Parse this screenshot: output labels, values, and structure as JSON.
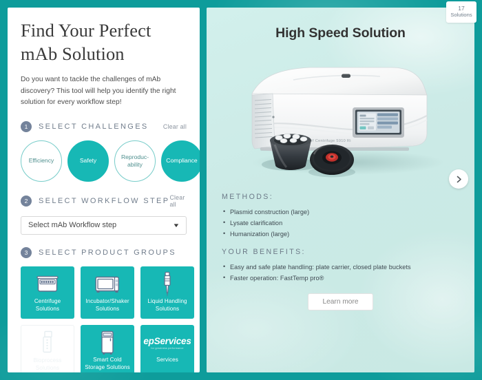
{
  "left": {
    "headline": "Find Your Perfect mAb Solution",
    "intro": "Do you want to tackle the challenges of mAb discovery? This tool will help you identify the right solution for every workflow step!",
    "sections": [
      {
        "number": "1",
        "title": "SELECT CHALLENGES",
        "clear_label": "Clear all"
      },
      {
        "number": "2",
        "title": "SELECT WORKFLOW STEP",
        "clear_label": "Clear all"
      },
      {
        "number": "3",
        "title": "SELECT PRODUCT GROUPS"
      }
    ],
    "challenges": [
      {
        "label": "Efficiency",
        "selected": false
      },
      {
        "label": "Safety",
        "selected": true
      },
      {
        "label": "Reproduc-ability",
        "selected": false
      },
      {
        "label": "Compliance",
        "selected": true
      }
    ],
    "workflow_select": {
      "value": "Select mAb Workflow step",
      "placeholder": "Select mAb Workflow step",
      "caret_icon": "chevron-down-icon"
    },
    "product_groups": [
      {
        "label": "Centrifuge Solutions",
        "icon": "centrifuge-icon",
        "disabled": false
      },
      {
        "label": "Incubator/Shaker Solutions",
        "icon": "incubator-shaker-icon",
        "disabled": false
      },
      {
        "label": "Liquid Handling Solutions",
        "icon": "pipette-icon",
        "disabled": false
      },
      {
        "label": "Bioprocess Solutions",
        "icon": "bioprocess-icon",
        "disabled": true
      },
      {
        "label": "Smart Cold Storage Solutions",
        "icon": "freezer-icon",
        "disabled": false
      },
      {
        "label": "Services",
        "icon": "epservices-logo-icon",
        "disabled": false,
        "logo_text": "epServices",
        "logo_tagline": "for greatness performance"
      }
    ]
  },
  "right": {
    "title": "High Speed Solution",
    "product_image_alt": "eppendorf-centrifuge-image",
    "next_button_icon": "chevron-right-icon",
    "methods_heading": "METHODS:",
    "methods": [
      "Plasmid construction (large)",
      "Lysate clarification",
      "Humanization (large)"
    ],
    "benefits_heading": "YOUR BENEFITS:",
    "benefits": [
      "Easy and safe plate handling: plate carrier, closed plate buckets",
      "Faster operation: FastTemp pro®"
    ],
    "learn_more_label": "Learn more"
  },
  "badge": {
    "count": "17",
    "label": "Solutions"
  },
  "colors": {
    "teal_frame": "#0e9c9b",
    "teal_accent": "#17b8b5",
    "panel_bg": "#cceeea",
    "step_badge": "#74839b",
    "heading_grey": "#6c7a88"
  }
}
